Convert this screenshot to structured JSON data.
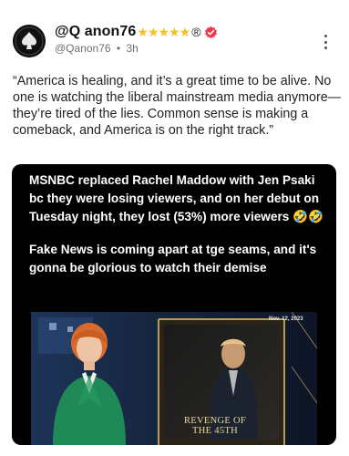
{
  "post": {
    "author": {
      "display_name": "@Q anon76",
      "badge_stars": "★★★★★",
      "badge_registered": "®",
      "handle": "@Qanon76",
      "time": "3h",
      "separator": "•"
    },
    "text": "“America is healing, and it’s a great time to be alive. No one is watching the liberal mainstream media anymore—they’re tired of the lies. Common sense is making a comeback, and America is on the right track.”",
    "media": {
      "caption_line1": "MSNBC replaced Rachel Maddow with Jen Psaki bc they were losing viewers, and on her debut on Tuesday night, they lost (53%) more viewers 🤣🤣",
      "caption_line2": "Fake News is coming apart at tge seams, and it's gonna be glorious to watch their demise",
      "video": {
        "date_overlay": "Nov. 12, 2023",
        "banner_line1": "REVENGE OF",
        "banner_line2": "THE 45TH"
      }
    }
  },
  "icons": {
    "verified": "verified-badge-icon",
    "more": "more-options-icon",
    "avatar": "spade-avatar"
  },
  "colors": {
    "verified_badge": "#f0384f",
    "stars": "#f5c02a",
    "media_background": "#000000",
    "banner_text": "#e8d7a4"
  }
}
